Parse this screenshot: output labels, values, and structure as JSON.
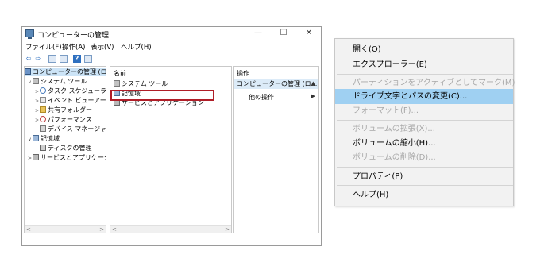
{
  "window": {
    "title": "コンピューターの管理",
    "controls": {
      "minimize": "—",
      "maximize": "☐",
      "close": "✕"
    }
  },
  "menu": [
    "ファイル(F)",
    "操作(A)",
    "表示(V)",
    "ヘルプ(H)"
  ],
  "toolbar": {
    "back": "⇦",
    "forward": "⇨",
    "help": "?"
  },
  "tree": [
    {
      "label": "コンピューターの管理 (ローカ",
      "arrow": "",
      "icon": "computer-icon"
    },
    {
      "label": "システム ツール",
      "arrow": "∨",
      "icon": "tools-icon"
    },
    {
      "label": "タスク スケジューラ",
      "arrow": ">",
      "icon": "clock-icon"
    },
    {
      "label": "イベント ビューアー",
      "arrow": ">",
      "icon": "event-viewer-icon"
    },
    {
      "label": "共有フォルダー",
      "arrow": ">",
      "icon": "folder-icon"
    },
    {
      "label": "パフォーマンス",
      "arrow": ">",
      "icon": "performance-icon"
    },
    {
      "label": "デバイス マネージャー",
      "arrow": "",
      "icon": "device-manager-icon"
    },
    {
      "label": "記憶域",
      "arrow": "∨",
      "icon": "storage-icon"
    },
    {
      "label": "ディスクの管理",
      "arrow": "",
      "icon": "disk-icon"
    },
    {
      "label": "サービスとアプリケーション",
      "arrow": ">",
      "icon": "services-icon"
    }
  ],
  "center": {
    "column_header": "名前",
    "items": [
      "システム ツール",
      "記憶域",
      "サービスとアプリケーション"
    ]
  },
  "actions": {
    "header": "操作",
    "group": "コンピューターの管理 (ロ...",
    "group_arrow": "▲",
    "other": "他の操作",
    "other_arrow": "▶"
  },
  "scroll": {
    "left": "<",
    "right": ">"
  },
  "context_menu": [
    {
      "label": "開く(O)",
      "state": "enabled"
    },
    {
      "label": "エクスプローラー(E)",
      "state": "enabled"
    },
    {
      "label": "パーティションをアクティブとしてマーク(M)",
      "state": "disabled"
    },
    {
      "label": "ドライブ文字とパスの変更(C)...",
      "state": "selected"
    },
    {
      "label": "フォーマット(F)...",
      "state": "disabled"
    },
    {
      "label": "ボリュームの拡張(X)...",
      "state": "disabled"
    },
    {
      "label": "ボリュームの縮小(H)...",
      "state": "enabled"
    },
    {
      "label": "ボリュームの削除(D)...",
      "state": "disabled"
    },
    {
      "label": "プロパティ(P)",
      "state": "enabled"
    },
    {
      "label": "ヘルプ(H)",
      "state": "enabled"
    }
  ],
  "colors": {
    "highlight_border": "#b01e28",
    "menu_selected": "#9fd0f2",
    "disabled_text": "#a8a8a8"
  }
}
